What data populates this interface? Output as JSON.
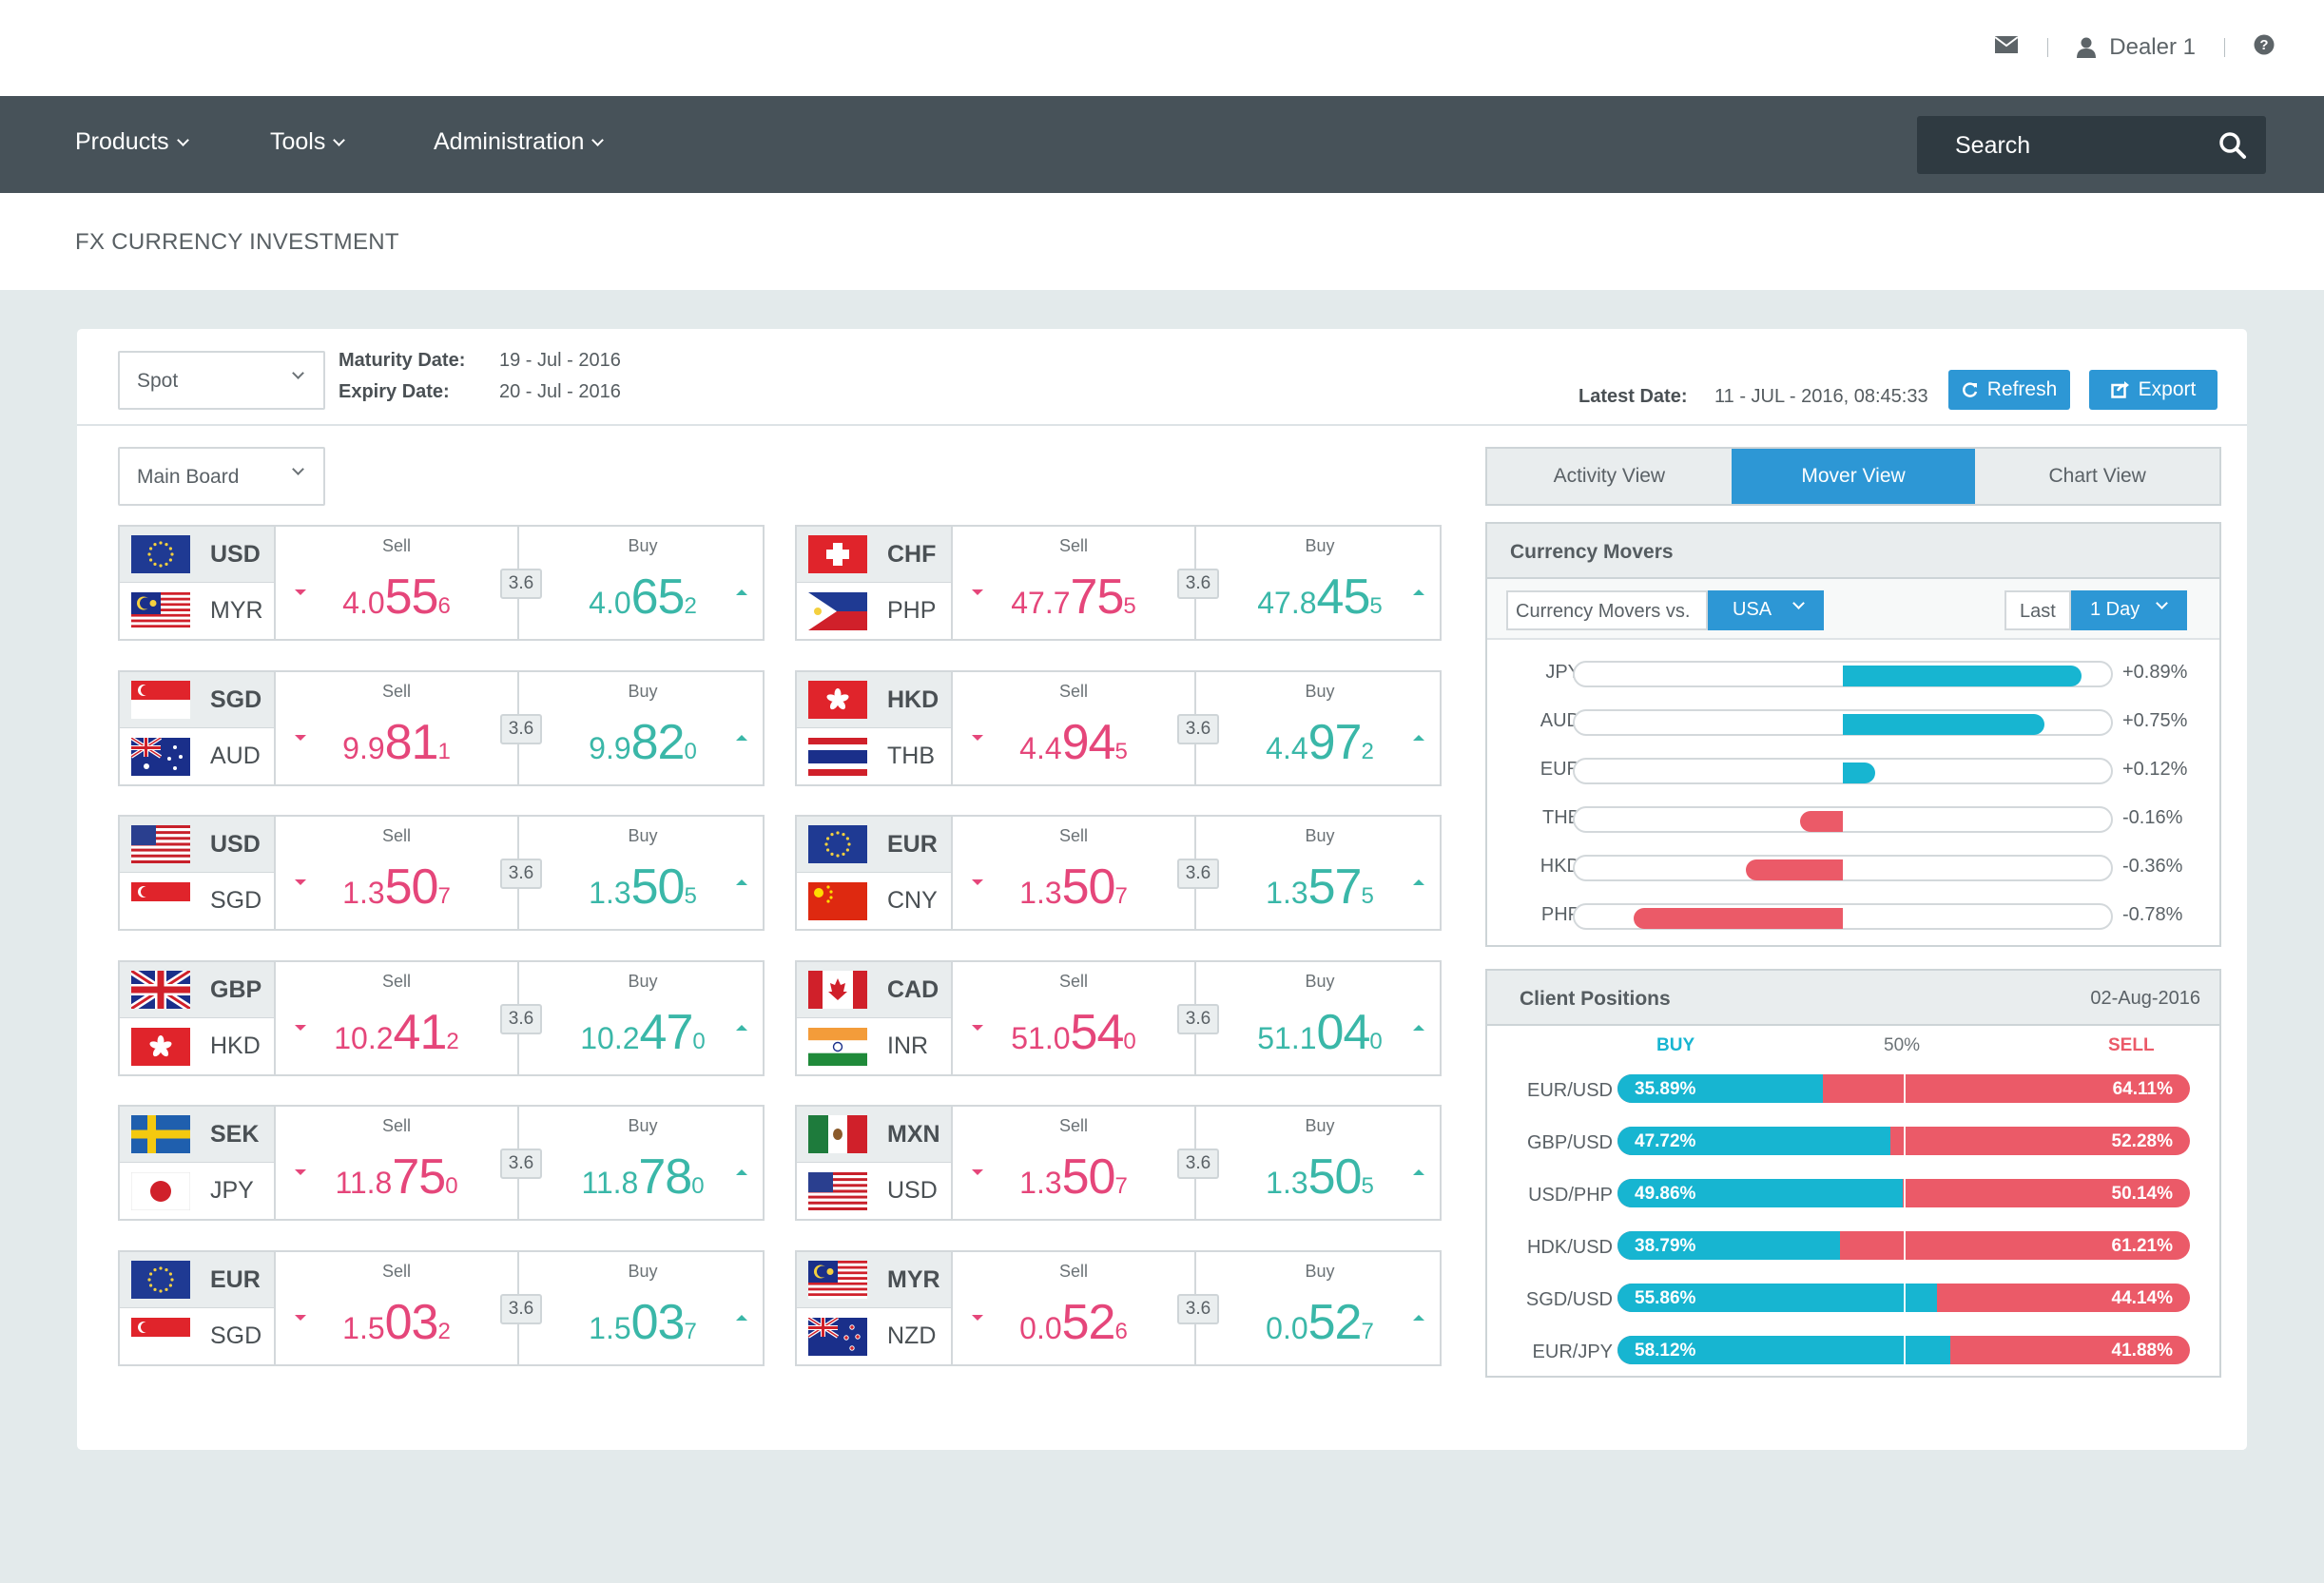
{
  "header": {
    "user": "Dealer 1"
  },
  "nav": {
    "products": "Products",
    "tools": "Tools",
    "administration": "Administration",
    "search_placeholder": "Search"
  },
  "page": {
    "title": "FX CURRENCY INVESTMENT"
  },
  "controls": {
    "type_select": "Spot",
    "maturity_label": "Maturity Date:",
    "maturity_value": "19 - Jul - 2016",
    "expiry_label": "Expiry Date:",
    "expiry_value": "20 - Jul - 2016",
    "latest_label": "Latest Date:",
    "latest_value": "11 - JUL - 2016, 08:45:33",
    "refresh": "Refresh",
    "export": "Export",
    "board_select": "Main Board"
  },
  "labels": {
    "sell": "Sell",
    "buy": "Buy"
  },
  "pairs": [
    {
      "base": "USD",
      "quote": "MYR",
      "bf": "eu",
      "qf": "my",
      "sell": [
        "4.0",
        "55",
        "6"
      ],
      "buy": [
        "4.0",
        "65",
        "2"
      ],
      "spread": "3.6"
    },
    {
      "base": "CHF",
      "quote": "PHP",
      "bf": "ch",
      "qf": "ph",
      "sell": [
        "47.7",
        "75",
        "5"
      ],
      "buy": [
        "47.8",
        "45",
        "5"
      ],
      "spread": "3.6"
    },
    {
      "base": "SGD",
      "quote": "AUD",
      "bf": "sg",
      "qf": "au",
      "sell": [
        "9.9",
        "81",
        "1"
      ],
      "buy": [
        "9.9",
        "82",
        "0"
      ],
      "spread": "3.6"
    },
    {
      "base": "HKD",
      "quote": "THB",
      "bf": "hk",
      "qf": "th",
      "sell": [
        "4.4",
        "94",
        "5"
      ],
      "buy": [
        "4.4",
        "97",
        "2"
      ],
      "spread": "3.6"
    },
    {
      "base": "USD",
      "quote": "SGD",
      "bf": "us",
      "qf": "sg",
      "sell": [
        "1.3",
        "50",
        "7"
      ],
      "buy": [
        "1.3",
        "50",
        "5"
      ],
      "spread": "3.6"
    },
    {
      "base": "EUR",
      "quote": "CNY",
      "bf": "eu",
      "qf": "cn",
      "sell": [
        "1.3",
        "50",
        "7"
      ],
      "buy": [
        "1.3",
        "57",
        "5"
      ],
      "spread": "3.6"
    },
    {
      "base": "GBP",
      "quote": "HKD",
      "bf": "gb",
      "qf": "hk",
      "sell": [
        "10.2",
        "41",
        "2"
      ],
      "buy": [
        "10.2",
        "47",
        "0"
      ],
      "spread": "3.6"
    },
    {
      "base": "CAD",
      "quote": "INR",
      "bf": "ca",
      "qf": "in",
      "sell": [
        "51.0",
        "54",
        "0"
      ],
      "buy": [
        "51.1",
        "04",
        "0"
      ],
      "spread": "3.6"
    },
    {
      "base": "SEK",
      "quote": "JPY",
      "bf": "se",
      "qf": "jp",
      "sell": [
        "11.8",
        "75",
        "0"
      ],
      "buy": [
        "11.8",
        "78",
        "0"
      ],
      "spread": "3.6"
    },
    {
      "base": "MXN",
      "quote": "USD",
      "bf": "mx",
      "qf": "us",
      "sell": [
        "1.3",
        "50",
        "7"
      ],
      "buy": [
        "1.3",
        "50",
        "5"
      ],
      "spread": "3.6"
    },
    {
      "base": "EUR",
      "quote": "SGD",
      "bf": "eu",
      "qf": "sg",
      "sell": [
        "1.5",
        "03",
        "2"
      ],
      "buy": [
        "1.5",
        "03",
        "7"
      ],
      "spread": "3.6"
    },
    {
      "base": "MYR",
      "quote": "NZD",
      "bf": "my",
      "qf": "nz",
      "sell": [
        "0.0",
        "52",
        "6"
      ],
      "buy": [
        "0.0",
        "52",
        "7"
      ],
      "spread": "3.6"
    }
  ],
  "views": {
    "activity": "Activity View",
    "mover": "Mover View",
    "chart": "Chart View"
  },
  "movers": {
    "title": "Currency Movers",
    "vs_label": "Currency Movers vs.",
    "vs_value": "USA",
    "last_label": "Last",
    "period_value": "1 Day",
    "items": [
      {
        "ccy": "JPY",
        "pct": 0.89,
        "label": "+0.89%"
      },
      {
        "ccy": "AUD",
        "pct": 0.75,
        "label": "+0.75%"
      },
      {
        "ccy": "EUR",
        "pct": 0.12,
        "label": "+0.12%"
      },
      {
        "ccy": "THB",
        "pct": -0.16,
        "label": "-0.16%"
      },
      {
        "ccy": "HKD",
        "pct": -0.36,
        "label": "-0.36%"
      },
      {
        "ccy": "PHP",
        "pct": -0.78,
        "label": "-0.78%"
      }
    ]
  },
  "positions": {
    "title": "Client Positions",
    "date": "02-Aug-2016",
    "buy_label": "BUY",
    "mid_label": "50%",
    "sell_label": "SELL",
    "items": [
      {
        "pair": "EUR/USD",
        "buy": 35.89,
        "buy_label": "35.89%",
        "sell_label": "64.11%"
      },
      {
        "pair": "GBP/USD",
        "buy": 47.72,
        "buy_label": "47.72%",
        "sell_label": "52.28%"
      },
      {
        "pair": "USD/PHP",
        "buy": 49.86,
        "buy_label": "49.86%",
        "sell_label": "50.14%"
      },
      {
        "pair": "HDK/USD",
        "buy": 38.79,
        "buy_label": "38.79%",
        "sell_label": "61.21%"
      },
      {
        "pair": "SGD/USD",
        "buy": 55.86,
        "buy_label": "55.86%",
        "sell_label": "44.14%"
      },
      {
        "pair": "EUR/JPY",
        "buy": 58.12,
        "buy_label": "58.12%",
        "sell_label": "41.88%"
      }
    ]
  },
  "colors": {
    "accent": "#2d97d5",
    "sell": "#e5467a",
    "buy": "#3ab7a8",
    "mover_pos": "#17b5d1",
    "mover_neg": "#eb5a68",
    "nav": "#475259"
  }
}
